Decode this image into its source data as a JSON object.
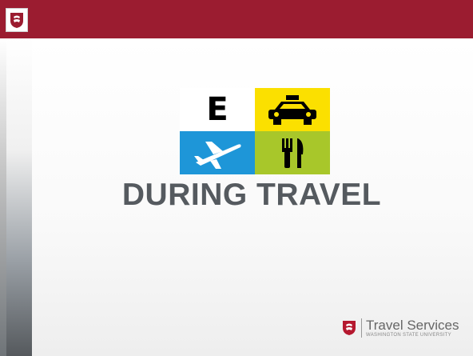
{
  "slide": {
    "title": "DURING TRAVEL"
  },
  "icons": {
    "tile_e_letter": "E",
    "tile_e_icon": "letter-e-icon",
    "tile_taxi_icon": "taxi-icon",
    "tile_plane_icon": "airplane-icon",
    "tile_food_icon": "fork-knife-icon"
  },
  "branding": {
    "name": "Travel Services",
    "subtitle": "WASHINGTON STATE UNIVERSITY"
  },
  "colors": {
    "header": "#9b1c30",
    "title": "#555a5f",
    "taxi_tile": "#fbe000",
    "plane_tile": "#1e96d8",
    "food_tile": "#a8c72a"
  }
}
